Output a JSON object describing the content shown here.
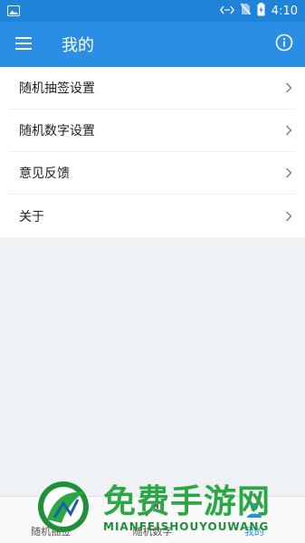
{
  "status_bar": {
    "time": "4:10",
    "icons": [
      "image-icon",
      "code-signal-icon",
      "no-sim-icon",
      "battery-charging-icon"
    ]
  },
  "app_bar": {
    "title": "我的",
    "menu_icon": "hamburger-menu-icon",
    "info_icon": "info-circle-icon"
  },
  "settings": {
    "items": [
      {
        "label": "随机抽签设置"
      },
      {
        "label": "随机数字设置"
      },
      {
        "label": "意见反馈"
      },
      {
        "label": "关于"
      }
    ]
  },
  "bottom_nav": {
    "items": [
      {
        "label": "随机抽签",
        "icon": "draw-lots-icon"
      },
      {
        "label": "随机数字",
        "icon": "dice-icon"
      },
      {
        "label": "我的",
        "icon": "person-icon",
        "active": true
      }
    ]
  },
  "watermark": {
    "title": "免费手游网",
    "subtitle": "MIANFEISHOUYOUWANG"
  },
  "colors": {
    "status_bar": "#1f83d8",
    "app_bar": "#2a8fe4",
    "background": "#eff2f5",
    "active_nav": "#2a8fe4",
    "watermark": "#2aa846"
  }
}
